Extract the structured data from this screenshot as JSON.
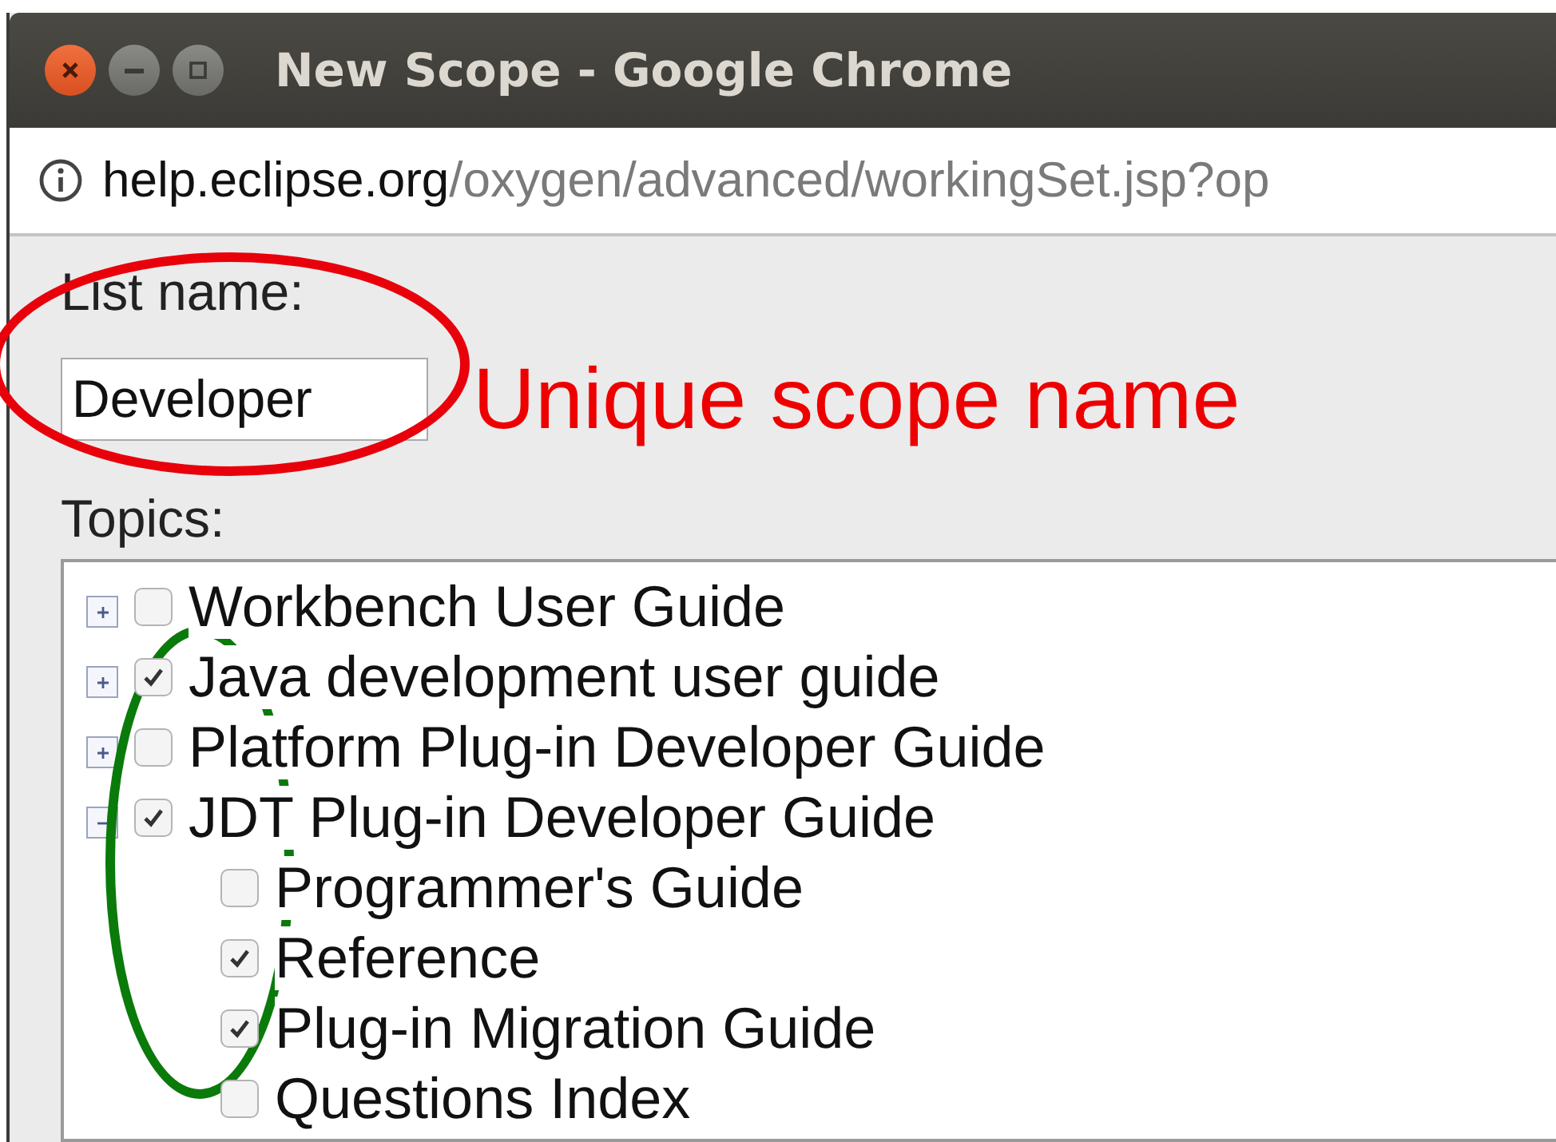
{
  "window": {
    "title": "New Scope - Google Chrome"
  },
  "address_bar": {
    "host": "help.eclipse.org",
    "path": "/oxygen/advanced/workingSet.jsp?op"
  },
  "list_name": {
    "label": "List name:",
    "value": "Developer"
  },
  "topics_label": "Topics:",
  "topics": [
    {
      "label": "Workbench User Guide",
      "checked": false,
      "expanded": false
    },
    {
      "label": "Java development user guide",
      "checked": true,
      "expanded": false
    },
    {
      "label": "Platform Plug-in Developer Guide",
      "checked": false,
      "expanded": false
    },
    {
      "label": "JDT Plug-in Developer Guide",
      "checked": true,
      "expanded": true,
      "children": [
        {
          "label": "Programmer's Guide",
          "checked": false
        },
        {
          "label": "Reference",
          "checked": true
        },
        {
          "label": "Plug-in Migration Guide",
          "checked": true
        },
        {
          "label": "Questions Index",
          "checked": false
        }
      ]
    }
  ],
  "annotations": {
    "callout": "Unique scope name",
    "circles": [
      {
        "color": "#e8000b"
      },
      {
        "color": "#0a7a0a"
      }
    ]
  }
}
